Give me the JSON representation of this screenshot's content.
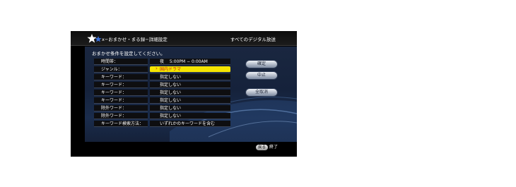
{
  "header": {
    "logo_icon": "star-tuner-icon",
    "title": "x−おまかせ・まる録−詳細設定",
    "broadcast": "すべてのデジタル放送"
  },
  "instruction": "おまかせ条件を設定してください。",
  "conditions": [
    {
      "label": "時間帯：",
      "value": "夜　 5:00PM − 0:00AM"
    },
    {
      "label": "ジャンル：",
      "value": "国内ドラマ",
      "selected": true
    },
    {
      "label": "キーワード：",
      "value": "指定しない"
    },
    {
      "label": "キーワード：",
      "value": "指定しない"
    },
    {
      "label": "キーワード：",
      "value": "指定しない"
    },
    {
      "label": "キーワード：",
      "value": "指定しない"
    },
    {
      "label": "除外ワード：",
      "value": "指定しない"
    },
    {
      "label": "除外ワード：",
      "value": "指定しない"
    },
    {
      "label": "キーワード検索方法：",
      "value": "いずれかのキーワードを含む"
    }
  ],
  "buttons": {
    "confirm": "確定",
    "cancel": "中止",
    "clear_all": "全取消"
  },
  "footer": {
    "key_label": "戻る",
    "action_label": "終了"
  },
  "colors": {
    "highlight": "#f5e400",
    "highlight_text": "#c01e1e",
    "panel": "#1a2740"
  }
}
